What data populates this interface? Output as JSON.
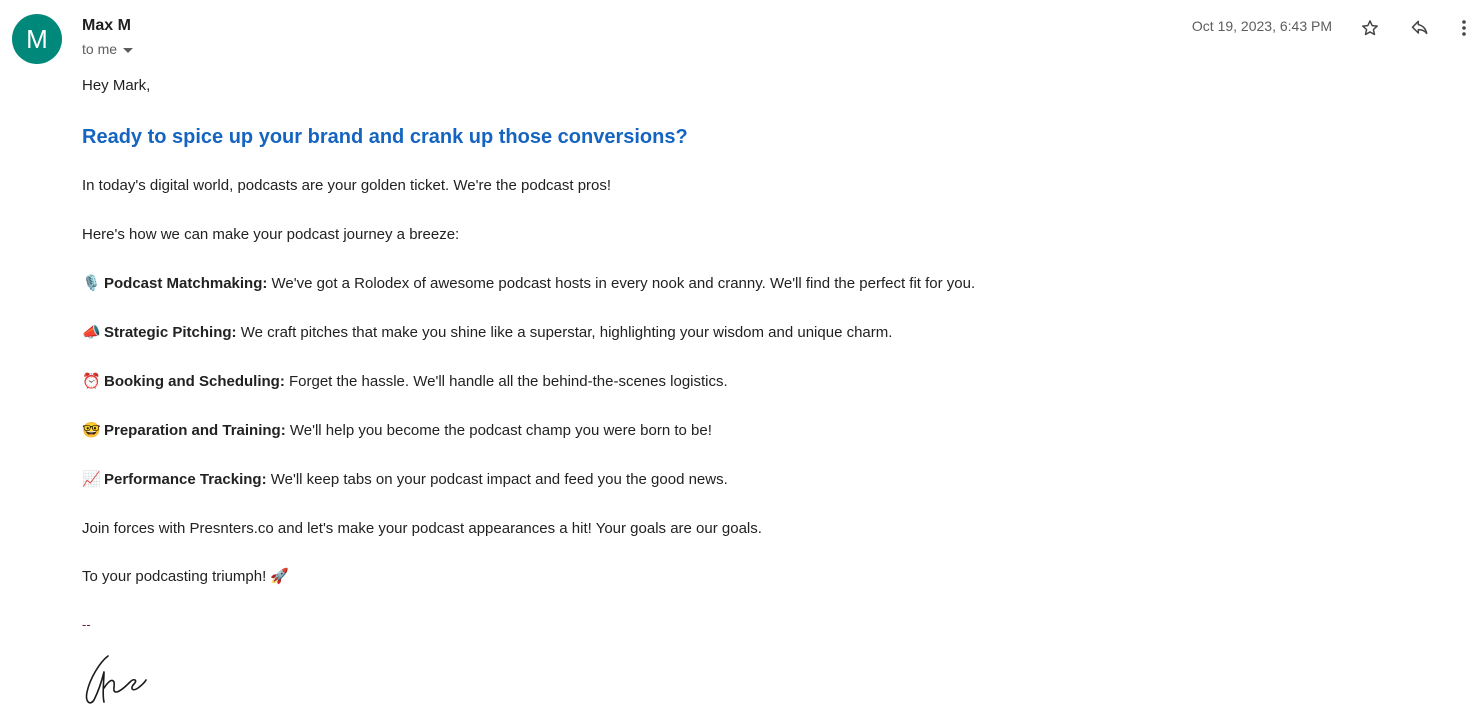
{
  "sender": {
    "avatar_letter": "M",
    "avatar_color": "#00897b",
    "name": "Max M",
    "recipients": "to me"
  },
  "date": "Oct 19, 2023, 6:43 PM",
  "actions": {
    "star": "star-icon",
    "reply": "reply-icon",
    "more": "more-vert-icon"
  },
  "email": {
    "greeting": "Hey Mark,",
    "headline": "Ready to spice up your brand and crank up those conversions?",
    "headline_color": "#1565c0",
    "intro": "In today's digital world, podcasts are your golden ticket. We're the podcast pros!",
    "lead_in": "Here's how we can make your podcast journey a breeze:",
    "features": [
      {
        "emoji": "🎙️",
        "title": "Podcast Matchmaking:",
        "text": " We've got a Rolodex of awesome podcast hosts in every nook and cranny. We'll find the perfect fit for you."
      },
      {
        "emoji": "📣",
        "title": "Strategic Pitching:",
        "text": " We craft pitches that make you shine like a superstar, highlighting your wisdom and unique charm."
      },
      {
        "emoji": "⏰",
        "title": "Booking and Scheduling:",
        "text": " Forget the hassle. We'll handle all the behind-the-scenes logistics."
      },
      {
        "emoji": "🤓",
        "title": "Preparation and Training:",
        "text": " We'll help you become the podcast champ you were born to be!"
      },
      {
        "emoji": "📈",
        "title": "Performance Tracking:",
        "text": " We'll keep tabs on your podcast impact and feed you the good news."
      }
    ],
    "closing": "Join forces with Presnters.co and let's make your podcast appearances a hit! Your goals are our goals.",
    "sign_off": "To your podcasting triumph! 🚀",
    "signature_dash": "--",
    "signature_name": "Che"
  }
}
